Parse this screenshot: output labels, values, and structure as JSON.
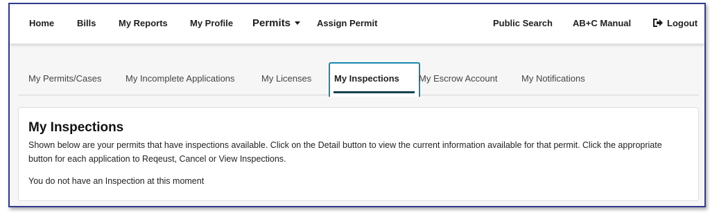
{
  "navbar": {
    "home": "Home",
    "bills": "Bills",
    "my_reports": "My Reports",
    "my_profile": "My Profile",
    "permits": "Permits",
    "assign_permit": "Assign Permit",
    "public_search": "Public Search",
    "abc_manual": "AB+C Manual",
    "logout": "Logout"
  },
  "tabs": [
    {
      "label": "My Permits/Cases",
      "active": false
    },
    {
      "label": "My Incomplete Applications",
      "active": false
    },
    {
      "label": "My Licenses",
      "active": false
    },
    {
      "label": "My Inspections",
      "active": true
    },
    {
      "label": "My Escrow Account",
      "active": false
    },
    {
      "label": "My Notifications",
      "active": false
    }
  ],
  "content": {
    "title": "My Inspections",
    "description": "Shown below are your permits that have inspections available. Click on the Detail button to view the current information available for that permit. Click the appropriate button for each application to Reqeust, Cancel or View Inspections.",
    "empty_message": "You do not have an Inspection at this moment"
  },
  "colors": {
    "frame_border": "#2f3a8f",
    "active_tab_outline": "#1589ad",
    "active_tab_underline": "#13404f"
  }
}
